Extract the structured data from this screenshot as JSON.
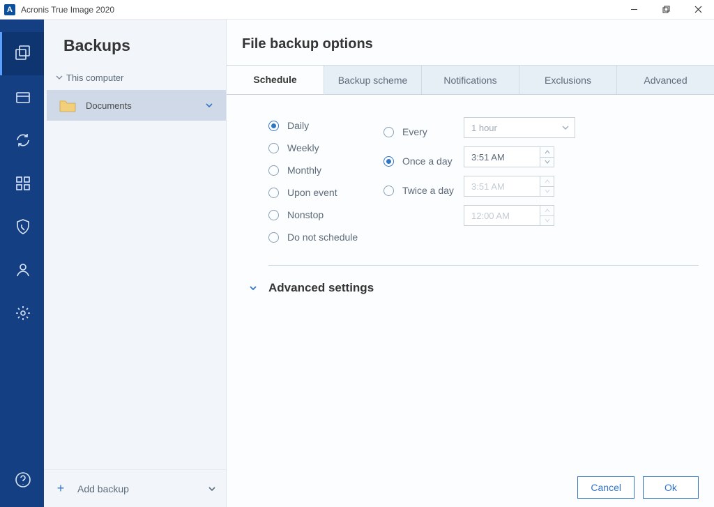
{
  "titlebar": {
    "icon_letter": "A",
    "title": "Acronis True Image 2020"
  },
  "sidebar": {
    "heading": "Backups",
    "computer_label": "This computer",
    "items": [
      {
        "label": "Documents"
      }
    ],
    "add_backup_label": "Add backup"
  },
  "main": {
    "heading": "File backup options",
    "tabs": [
      "Schedule",
      "Backup scheme",
      "Notifications",
      "Exclusions",
      "Advanced"
    ],
    "active_tab": 0,
    "schedule": {
      "period_options": [
        "Daily",
        "Weekly",
        "Monthly",
        "Upon event",
        "Nonstop",
        "Do not schedule"
      ],
      "period_selected": 0,
      "freq_options": [
        "Every",
        "Once a day",
        "Twice a day"
      ],
      "freq_selected": 1,
      "every_value": "1 hour",
      "once_time": "3:51 AM",
      "twice_time1": "3:51 AM",
      "twice_time2": "12:00 AM"
    },
    "advanced_settings_label": "Advanced settings"
  },
  "footer": {
    "cancel": "Cancel",
    "ok": "Ok"
  }
}
